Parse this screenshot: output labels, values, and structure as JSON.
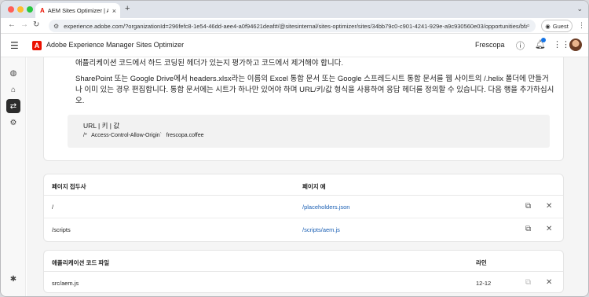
{
  "browser": {
    "tab_title": "AEM Sites Optimizer | Adobe",
    "tab_close": "×",
    "new_tab": "+",
    "url": "experience.adobe.com/?organizationId=296fefc8-1e54-46dd-aee4-a0f94621deaf#/@sitesinternal/sites-optimizer/sites/34bb79c0-c901-4241-929e-a9c930560e03/opportunities/bfae07e2…",
    "guest_label": "Guest"
  },
  "header": {
    "app_title": "Adobe Experience Manager Sites Optimizer",
    "org_name": "Frescopa"
  },
  "main": {
    "intro_line": "애플리케이션 코드에서 하드 코딩된 헤더가 있는지 평가하고 코드에서 제거해야 합니다.",
    "instructions": "SharePoint 또는 Google Drive에서 headers.xlsx라는 이름의 Excel 통합 문서 또는 Google 스프레드시트 통합 문서를 웹 사이트의 /.helix 폴더에 만들거나 이미 있는 경우 편집합니다. 통합 문서에는 시트가 하나만 있어야 하며 URL/키/값 형식을 사용하여 응답 헤더를 정의할 수 있습니다. 다음 행을 추가하십시오.",
    "code_header": "URL | 키 | 값",
    "code_row": "/*   Access-Control-Allow-Origin`   frescopa.coffee"
  },
  "accessors_table": {
    "headers": [
      "페이지 접두사",
      "페이지 예"
    ],
    "rows": [
      {
        "prefix": "/",
        "example": "/placeholders.json"
      },
      {
        "prefix": "/scripts",
        "example": "/scripts/aem.js"
      }
    ]
  },
  "code_files_table": {
    "headers": [
      "애플리케이션 코드 파일",
      "라인"
    ],
    "rows": [
      {
        "file": "src/aem.js",
        "line": "12-12"
      }
    ]
  }
}
